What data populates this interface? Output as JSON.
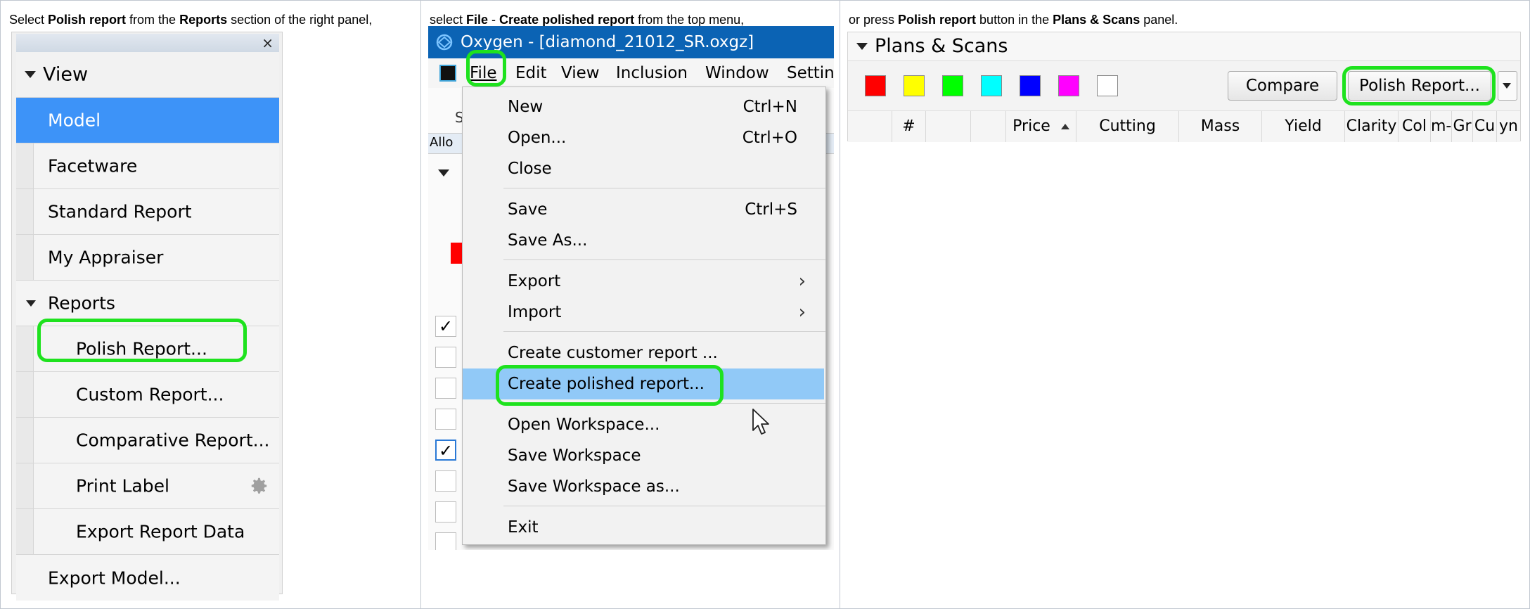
{
  "captions": {
    "col1": [
      "Select ",
      "Polish report",
      " from the ",
      "Reports",
      " section of the right panel,"
    ],
    "col2": [
      "select ",
      "File",
      " - ",
      "Create polished report",
      " from the top menu,"
    ],
    "col3": [
      "or press ",
      "Polish report",
      " button in the ",
      "Plans & Scans",
      " panel."
    ]
  },
  "side_panel": {
    "close_glyph": "×",
    "view_header": "View",
    "items": [
      "Model",
      "Facetware",
      "Standard Report",
      "My Appraiser"
    ],
    "reports_header": "Reports",
    "report_items": [
      "Polish Report...",
      "Custom Report...",
      "Comparative Report...",
      "Print Label",
      "Export Report Data"
    ],
    "export_model": "Export Model...",
    "highlighted": "Polish Report..."
  },
  "app": {
    "title": "Oxygen - [diamond_21012_SR.oxgz]",
    "menubar": [
      "File",
      "Edit",
      "View",
      "Inclusion",
      "Window",
      "Settin"
    ],
    "file_menu": {
      "group1": [
        {
          "label": "New",
          "shortcut": "Ctrl+N"
        },
        {
          "label": "Open...",
          "shortcut": "Ctrl+O"
        },
        {
          "label": "Close",
          "shortcut": ""
        }
      ],
      "group2": [
        {
          "label": "Save",
          "shortcut": "Ctrl+S"
        },
        {
          "label": "Save As...",
          "shortcut": ""
        }
      ],
      "group3": [
        "Export",
        "Import"
      ],
      "group4": [
        "Create customer report ...",
        "Create polished report..."
      ],
      "group5": [
        "Open Workspace...",
        "Save Workspace",
        "Save Workspace as..."
      ],
      "group6": [
        "Exit"
      ],
      "highlighted": "Create polished report..."
    },
    "background_labels": [
      "S",
      "Allo"
    ]
  },
  "plans_scans": {
    "title": "Plans & Scans",
    "swatches": [
      "#ff0000",
      "#ffff00",
      "#00ff00",
      "#00ffff",
      "#0000ff",
      "#ff00ff",
      "#ffffff"
    ],
    "compare_label": "Compare",
    "polish_label": "Polish Report...",
    "columns": [
      "#",
      "",
      "",
      "Price",
      "Cutting",
      "Mass",
      "Yield",
      "Clarity",
      "Col",
      "m-",
      "Gr",
      "Cu",
      "yn"
    ]
  },
  "colors": {
    "highlight": "#1ee21e",
    "selection": "#3d93f8",
    "titlebar": "#0b63b4",
    "menu_hover": "#91c9f7"
  }
}
